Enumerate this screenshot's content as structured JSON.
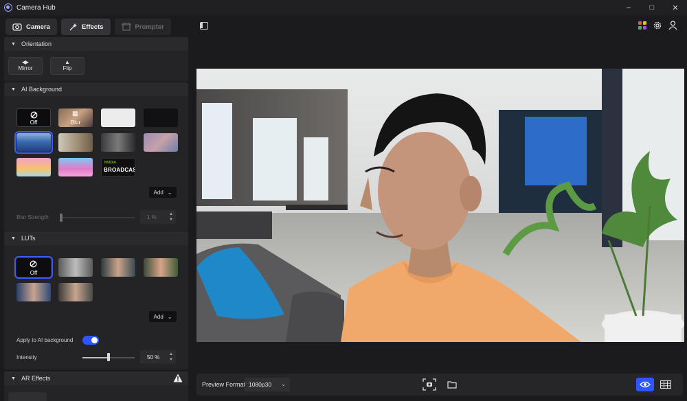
{
  "window": {
    "title": "Camera Hub"
  },
  "tabs": [
    {
      "label": "Camera",
      "icon": "camera-icon"
    },
    {
      "label": "Effects",
      "icon": "magic-wand-icon"
    },
    {
      "label": "Prompter",
      "icon": "prompter-icon"
    }
  ],
  "orientation": {
    "title": "Orientation",
    "buttons": [
      {
        "label": "Mirror",
        "icon": "mirror-icon"
      },
      {
        "label": "Flip",
        "icon": "flip-icon"
      }
    ]
  },
  "ai_background": {
    "title": "AI Background",
    "items": [
      {
        "label": "Off",
        "icon": "off-icon"
      },
      {
        "label": "Blur",
        "icon": "blur-icon"
      },
      {
        "label": ""
      },
      {
        "label": ""
      },
      {
        "label": ""
      },
      {
        "label": ""
      },
      {
        "label": ""
      },
      {
        "label": ""
      },
      {
        "label": ""
      },
      {
        "label": ""
      },
      {
        "label": "BROADCAST",
        "sublabel": "NVIDIA"
      }
    ],
    "add_label": "Add",
    "blur_strength_label": "Blur Strength",
    "blur_strength_value": "1 %"
  },
  "luts": {
    "title": "LUTs",
    "off_label": "Off",
    "add_label": "Add",
    "apply_label": "Apply to AI background",
    "apply_enabled": true,
    "intensity_label": "Intensity",
    "intensity_value": "50 %",
    "intensity_level": 0.5
  },
  "ar_effects": {
    "title": "AR Effects"
  },
  "bottom": {
    "preview_format_label": "Preview Format",
    "preview_format_value": "1080p30"
  },
  "colors": {
    "accent": "#2f55ff",
    "panel": "#242426",
    "background": "#1b1b1d"
  }
}
